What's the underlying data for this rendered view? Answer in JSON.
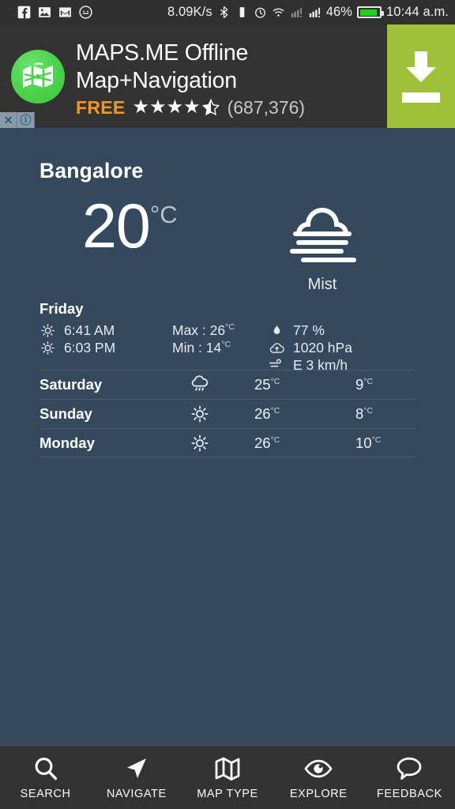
{
  "statusbar": {
    "app_icons": [
      "facebook-icon",
      "photos-icon",
      "gmail-icon",
      "messenger-icon"
    ],
    "network_speed": "8.09K/s",
    "indicators": [
      "bluetooth-icon",
      "vibrate-icon",
      "alarm-icon",
      "wifi-icon",
      "signal-1-icon",
      "signal-2-icon"
    ],
    "battery_percent": "46%",
    "time": "10:44 a.m."
  },
  "ad": {
    "icon_name": "mapsme-app-icon",
    "title_line1": "MAPS.ME Offline",
    "title_line2": "Map+Navigation",
    "price": "FREE",
    "rating": 4.5,
    "rating_stars": "★★★★",
    "half_star": "★",
    "review_count": "(687,376)",
    "download_label": "download-icon",
    "close_label": "✕",
    "info_label": "ⓘ",
    "accent_color": "#9fc03a",
    "price_color": "#f0962a",
    "background_color": "#333333"
  },
  "weather": {
    "city": "Bangalore",
    "temperature": "20",
    "unit": "°C",
    "condition": "Mist",
    "condition_icon": "mist-icon",
    "today": {
      "day": "Friday",
      "sunrise": "6:41 AM",
      "sunset": "6:03 PM",
      "sunrise_icon": "sunrise-icon",
      "sunset_icon": "sunset-icon",
      "max_label": "Max : 26",
      "max_unit": "°C",
      "min_label": "Min : 14",
      "min_unit": "°C",
      "humidity": "77 %",
      "humidity_icon": "humidity-icon",
      "pressure": "1020 hPa",
      "pressure_icon": "pressure-icon",
      "wind": "E 3 km/h",
      "wind_icon": "wind-icon"
    },
    "forecast": [
      {
        "day": "Saturday",
        "icon": "rain-icon",
        "high": "25",
        "low": "9",
        "unit": "°C"
      },
      {
        "day": "Sunday",
        "icon": "sun-icon",
        "high": "26",
        "low": "8",
        "unit": "°C"
      },
      {
        "day": "Monday",
        "icon": "sun-icon",
        "high": "26",
        "low": "10",
        "unit": "°C"
      }
    ],
    "background_color": "#35495e"
  },
  "navbar": {
    "items": [
      {
        "label": "SEARCH",
        "icon": "search-icon"
      },
      {
        "label": "NAVIGATE",
        "icon": "navigate-arrow-icon"
      },
      {
        "label": "MAP TYPE",
        "icon": "map-fold-icon"
      },
      {
        "label": "EXPLORE",
        "icon": "eye-icon"
      },
      {
        "label": "FEEDBACK",
        "icon": "speech-bubble-icon"
      }
    ],
    "background_color": "#333333"
  }
}
